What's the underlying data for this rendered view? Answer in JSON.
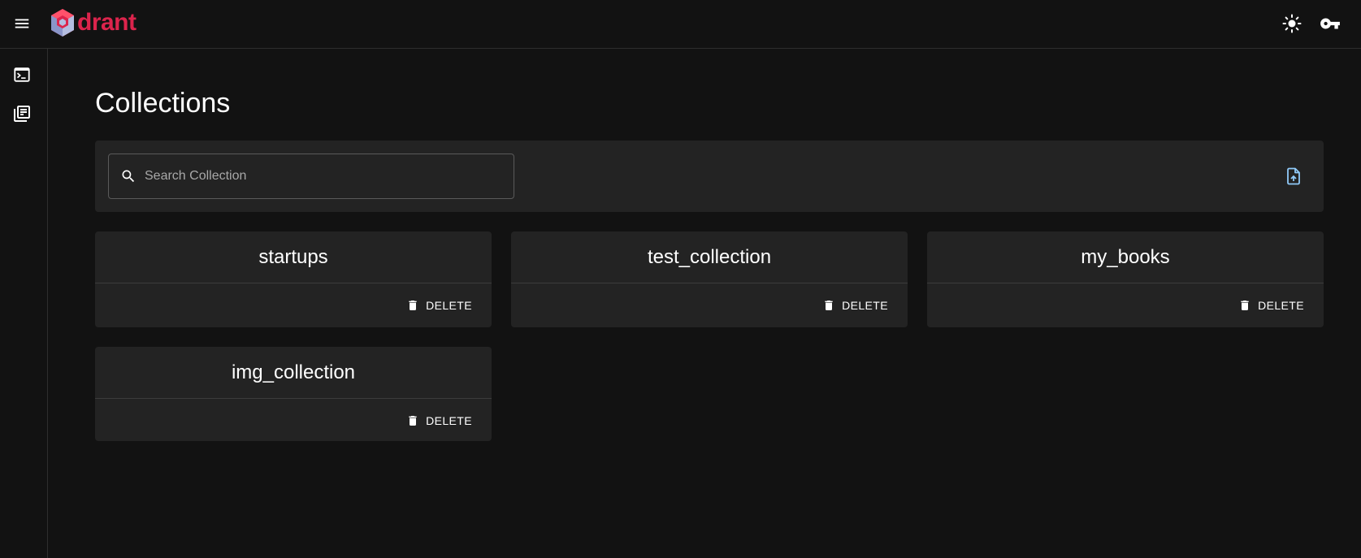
{
  "app": {
    "logo_text": "drant"
  },
  "header": {
    "menu_icon": "hamburger-menu-icon",
    "theme_icon": "sun-icon",
    "key_icon": "key-icon"
  },
  "sidebar": {
    "items": [
      {
        "name": "console",
        "icon": "terminal-icon"
      },
      {
        "name": "collections",
        "icon": "library-books-icon"
      }
    ]
  },
  "main": {
    "title": "Collections",
    "search": {
      "placeholder": "Search Collection",
      "value": ""
    },
    "upload_icon": "upload-file-icon",
    "collections": [
      {
        "name": "startups",
        "delete_label": "DELETE"
      },
      {
        "name": "test_collection",
        "delete_label": "DELETE"
      },
      {
        "name": "my_books",
        "delete_label": "DELETE"
      },
      {
        "name": "img_collection",
        "delete_label": "DELETE"
      }
    ]
  },
  "colors": {
    "background": "#121212",
    "surface": "#232323",
    "brand_red": "#dc244c",
    "accent_blue": "#90caf9"
  }
}
